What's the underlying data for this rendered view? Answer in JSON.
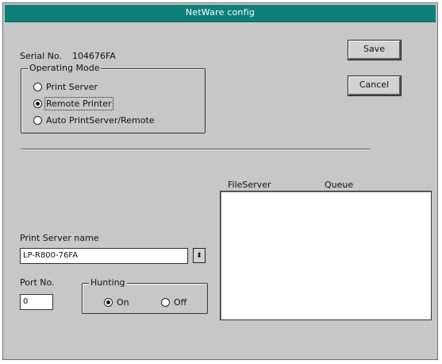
{
  "window": {
    "title": "NetWare config"
  },
  "serial": {
    "label": "Serial No.",
    "value": "104676FA"
  },
  "operating_mode": {
    "legend": "Operating Mode",
    "options": [
      {
        "label": "Print Server",
        "selected": false
      },
      {
        "label": "Remote Printer",
        "selected": true
      },
      {
        "label": "Auto PrintServer/Remote",
        "selected": false
      }
    ]
  },
  "buttons": {
    "save": "Save",
    "cancel": "Cancel"
  },
  "table": {
    "col_fileserver": "FileServer",
    "col_queue": "Queue",
    "rows": []
  },
  "print_server": {
    "label": "Print Server name",
    "value": "LP-R800-76FA",
    "spin_glyph": "⬍"
  },
  "port": {
    "label": "Port No.",
    "value": "0"
  },
  "hunting": {
    "legend": "Hunting",
    "on_label": "On",
    "off_label": "Off",
    "selected": "On"
  }
}
